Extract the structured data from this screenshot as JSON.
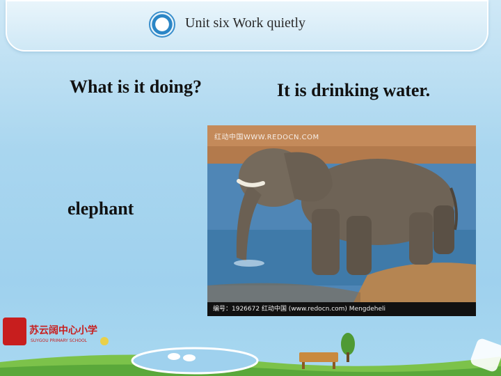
{
  "header": {
    "title": "Unit six  Work quietly"
  },
  "main": {
    "question": "What is it doing?",
    "answer": "It is drinking water.",
    "word": "elephant"
  },
  "photo": {
    "watermark_top": "红动中国WWW.REDOCN.COM",
    "watermark_bottom": "编号：1926672    红动中国 (www.redocn.com)    Mengdeheli"
  },
  "school": {
    "name": "苏云阔中心小学",
    "name_en": "SUYGOU PRIMARY SCHOOL"
  },
  "colors": {
    "banner": "#cfe8f6",
    "accent_red": "#c81e1e"
  }
}
